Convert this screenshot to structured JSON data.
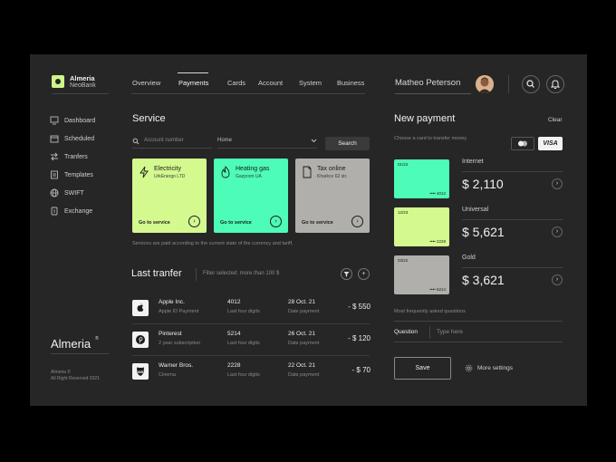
{
  "brand": {
    "name": "Almeria",
    "sub": "NeoBank",
    "footer_logo": "Almeria",
    "copyright_1": "Almeria ©",
    "copyright_2": "All Right Reserved 2021"
  },
  "nav": {
    "items": [
      "Overview",
      "Payments",
      "Cards",
      "Account",
      "System",
      "Business"
    ],
    "active": "Payments"
  },
  "user": {
    "name": "Matheo Peterson"
  },
  "sidebar": {
    "items": [
      "Dashboard",
      "Scheduled",
      "Tranfers",
      "Templates",
      "SWIFT",
      "Exchange"
    ]
  },
  "service": {
    "title": "Service",
    "search_placeholder": "Account number",
    "select_value": "Home",
    "search_button": "Search",
    "cards": [
      {
        "title": "Electricity",
        "sub": "UrkEnergo LTD",
        "go": "Go to service",
        "color": "#d4f98f"
      },
      {
        "title": "Heating gas",
        "sub": "Gazprom UA",
        "go": "Go to service",
        "color": "#4dfcb6"
      },
      {
        "title": "Tax online",
        "sub": "Kharkov 62 str.",
        "go": "Go to service",
        "color": "#b0afac"
      }
    ],
    "note": "Services are paid according to the current state of the currency and tariff."
  },
  "transfers": {
    "title": "Last tranfer",
    "filter": "Filter selected: more than 100 $",
    "rows": [
      {
        "name": "Apple Inc.",
        "sub": "Apple ID Payment",
        "digits": "4012",
        "digits_label": "Last four digits",
        "date": "28 Oct. 21",
        "date_label": "Date payment",
        "amount": "- $ 550"
      },
      {
        "name": "Pinterest",
        "sub": "2 year subscription",
        "digits": "5214",
        "digits_label": "Last four digits",
        "date": "26 Oct. 21",
        "date_label": "Date payment",
        "amount": "- $ 120"
      },
      {
        "name": "Warner Bros.",
        "sub": "Cinema",
        "digits": "2228",
        "digits_label": "Last four digits",
        "date": "22 Oct. 21",
        "date_label": "Date payment",
        "amount": "- $ 70"
      }
    ]
  },
  "payment": {
    "title": "New payment",
    "clear": "Clear",
    "choose": "Choose a card to transfer money",
    "visa": "VISA",
    "cards": [
      {
        "date": "01/22",
        "num": "•••• 4012",
        "color": "#4dfcb6",
        "account": "Internet",
        "amount": "$ 2,110"
      },
      {
        "date": "12/23",
        "num": "•••• 2228",
        "color": "#d4f98f",
        "account": "Universal",
        "amount": "$ 5,621"
      },
      {
        "date": "03/22",
        "num": "•••• 5214",
        "color": "#b0afac",
        "account": "Gold",
        "amount": "$ 3,621"
      }
    ],
    "faq": "Most frequently asked questions",
    "question_label": "Question",
    "question_placeholder": "Type here",
    "save": "Save",
    "more": "More settings"
  },
  "icons": {
    "brand": "almeria-logo-icon",
    "search": "search-icon",
    "bell": "bell-icon",
    "avatar": "avatar-icon"
  }
}
